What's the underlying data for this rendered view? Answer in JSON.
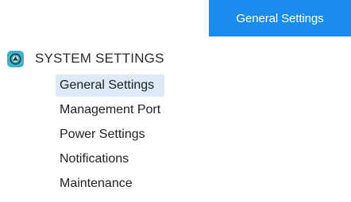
{
  "header": {
    "active_tab_label": "General Settings"
  },
  "sidebar": {
    "section": {
      "title": "SYSTEM SETTINGS",
      "icon": "system-settings-icon"
    },
    "items": [
      {
        "label": "General Settings",
        "selected": true
      },
      {
        "label": "Management Port",
        "selected": false
      },
      {
        "label": "Power Settings",
        "selected": false
      },
      {
        "label": "Notifications",
        "selected": false
      },
      {
        "label": "Maintenance",
        "selected": false
      }
    ]
  },
  "colors": {
    "accent": "#1a8cf0",
    "selected_background": "#dde9f7",
    "section_icon": "#3fb4c8"
  }
}
